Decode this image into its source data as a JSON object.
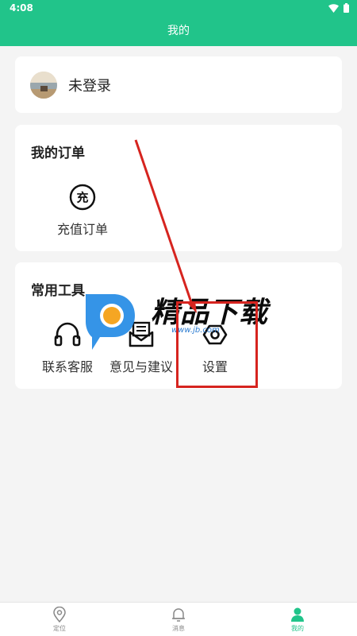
{
  "status_bar": {
    "time": "4:08"
  },
  "header": {
    "title": "我的"
  },
  "profile": {
    "login_text": "未登录"
  },
  "orders": {
    "title": "我的订单",
    "items": [
      {
        "label": "充值订单",
        "icon": "recharge-icon",
        "glyph": "充"
      }
    ]
  },
  "tools": {
    "title": "常用工具",
    "items": [
      {
        "label": "联系客服",
        "icon": "headset-icon"
      },
      {
        "label": "意见与建议",
        "icon": "mail-icon"
      },
      {
        "label": "设置",
        "icon": "gear-icon"
      }
    ]
  },
  "watermark": {
    "text": "精品下载",
    "url": "www.jb.com"
  },
  "bottom_nav": {
    "items": [
      {
        "label": "定位",
        "icon": "location-icon"
      },
      {
        "label": "消息",
        "icon": "bell-icon"
      },
      {
        "label": "我的",
        "icon": "person-icon",
        "active": true
      }
    ]
  },
  "colors": {
    "brand": "#21c48a",
    "annotation": "#d6241f"
  }
}
